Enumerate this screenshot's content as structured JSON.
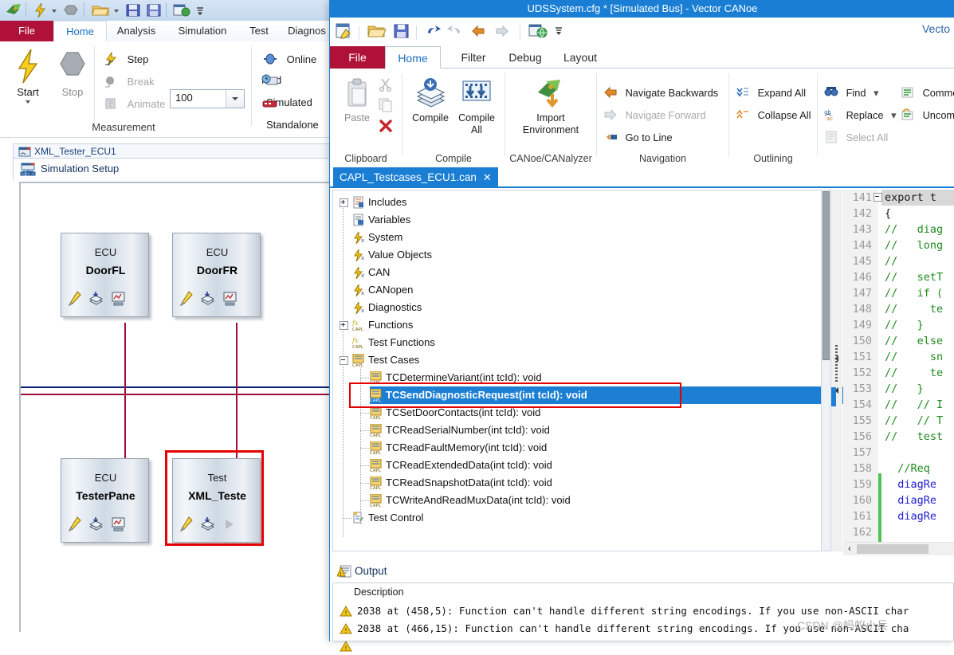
{
  "canoe": {
    "title": "UDSSystem.cfg * [Simulated Bus] - Vector CANoe",
    "tabs": [
      {
        "label": "File"
      },
      {
        "label": "Home"
      },
      {
        "label": "Analysis"
      },
      {
        "label": "Simulation"
      },
      {
        "label": "Test"
      },
      {
        "label": "Diagnos"
      }
    ],
    "ribbon": {
      "start_label": "Start",
      "stop_label": "Stop",
      "step_label": "Step",
      "break_label": "Break",
      "animate_label": "Animate",
      "step_value": "100",
      "online_mode_label": "Online Mod",
      "simulated_label": "Simulated",
      "standalone_label": "Standalone",
      "group_measurement": "Measurement"
    },
    "doc_tab": "XML_Tester_ECU1",
    "sim_header": "Simulation Setup",
    "nodes": [
      {
        "kind": "ECU",
        "name": "DoorFL",
        "selected": false,
        "third_icon": "measurement-icon"
      },
      {
        "kind": "ECU",
        "name": "DoorFR",
        "selected": false,
        "third_icon": "measurement-icon"
      },
      {
        "kind": "ECU",
        "name": "TesterPane",
        "selected": false,
        "third_icon": "measurement-icon"
      },
      {
        "kind": "Test",
        "name": "XML_Teste",
        "selected": true,
        "third_icon": "play-icon"
      }
    ],
    "colors": {
      "bus_primary": "#a10e3c",
      "bus_secondary": "#0a1f72",
      "selection_red": "#e60000",
      "file_tab": "#b01138"
    }
  },
  "capl": {
    "title": "UDSSystem.cfg * [Simulated Bus] - Vector CANoe",
    "brand": "Vecto",
    "tabs": [
      {
        "label": "File"
      },
      {
        "label": "Home"
      },
      {
        "label": "Filter"
      },
      {
        "label": "Debug"
      },
      {
        "label": "Layout"
      }
    ],
    "ribbon": {
      "clipboard": {
        "title": "Clipboard",
        "paste": "Paste",
        "cut_icon": "scissors-icon",
        "copy_icon": "copy-icon",
        "delete_icon": "delete-icon"
      },
      "compile": {
        "title": "Compile",
        "compile": "Compile",
        "compile_all_line1": "Compile",
        "compile_all_line2": "All"
      },
      "canoe": {
        "title": "CANoe/CANalyzer",
        "import_line1": "Import",
        "import_line2": "Environment"
      },
      "navigation": {
        "title": "Navigation",
        "navigate_backwards": "Navigate Backwards",
        "navigate_forward": "Navigate Forward",
        "go_to_line": "Go to Line"
      },
      "outlining": {
        "title": "Outlining",
        "expand_all": "Expand All",
        "collapse_all": "Collapse All"
      },
      "editing": {
        "find": "Find",
        "replace": "Replace",
        "select_all": "Select All",
        "comment": "Commen",
        "uncomment": "Uncomm"
      }
    },
    "file_tab": {
      "name": "CAPL_Testcases_ECU1.can",
      "close": "✕"
    },
    "tree": [
      {
        "label": "Includes",
        "icon": "includes-icon",
        "indent": 0,
        "expander": "plus"
      },
      {
        "label": "Variables",
        "icon": "variables-icon",
        "indent": 0,
        "expander": "none"
      },
      {
        "label": "System",
        "icon": "fx-bolt-icon",
        "indent": 0,
        "expander": "none"
      },
      {
        "label": "Value Objects",
        "icon": "fx-bolt-icon",
        "indent": 0,
        "expander": "none"
      },
      {
        "label": "CAN",
        "icon": "fx-bolt-icon",
        "indent": 0,
        "expander": "none"
      },
      {
        "label": "CANopen",
        "icon": "fx-bolt-icon",
        "indent": 0,
        "expander": "none"
      },
      {
        "label": "Diagnostics",
        "icon": "fx-bolt-icon",
        "indent": 0,
        "expander": "none"
      },
      {
        "label": "Functions",
        "icon": "fx-capl-icon",
        "indent": 0,
        "expander": "plus"
      },
      {
        "label": "Test Functions",
        "icon": "fx-capl-icon",
        "indent": 0,
        "expander": "none"
      },
      {
        "label": "Test Cases",
        "icon": "testcase-icon",
        "indent": 0,
        "expander": "minus"
      }
    ],
    "test_cases": [
      {
        "label": "TCDetermineVariant(int tcId): void",
        "selected": false
      },
      {
        "label": "TCSendDiagnosticRequest(int tcId): void",
        "selected": true
      },
      {
        "label": "TCSetDoorContacts(int tcId): void",
        "selected": false
      },
      {
        "label": "TCReadSerialNumber(int tcId): void",
        "selected": false
      },
      {
        "label": "TCReadFaultMemory(int tcId): void",
        "selected": false
      },
      {
        "label": "TCReadExtendedData(int tcId): void",
        "selected": false
      },
      {
        "label": "TCReadSnapshotData(int tcId): void",
        "selected": false
      },
      {
        "label": "TCWriteAndReadMuxData(int tcId): void",
        "selected": false
      }
    ],
    "test_control": {
      "label": "Test Control",
      "icon": "testcontrol-icon"
    },
    "code": {
      "first_line": 141,
      "lines": [
        {
          "n": 141,
          "text": "export t",
          "cls": "kw",
          "changed": false
        },
        {
          "n": 142,
          "text": "{",
          "cls": "kw",
          "changed": false
        },
        {
          "n": 143,
          "text": "//   diag",
          "cls": "cm",
          "changed": false
        },
        {
          "n": 144,
          "text": "//   long",
          "cls": "cm",
          "changed": false
        },
        {
          "n": 145,
          "text": "//",
          "cls": "cm",
          "changed": false
        },
        {
          "n": 146,
          "text": "//   setT",
          "cls": "cm",
          "changed": false
        },
        {
          "n": 147,
          "text": "//   if (",
          "cls": "cm",
          "changed": false
        },
        {
          "n": 148,
          "text": "//     te",
          "cls": "cm",
          "changed": false
        },
        {
          "n": 149,
          "text": "//   }",
          "cls": "cm",
          "changed": false
        },
        {
          "n": 150,
          "text": "//   else",
          "cls": "cm",
          "changed": false
        },
        {
          "n": 151,
          "text": "//     sn",
          "cls": "cm",
          "changed": false
        },
        {
          "n": 152,
          "text": "//     te",
          "cls": "cm",
          "changed": false
        },
        {
          "n": 153,
          "text": "//   }",
          "cls": "cm",
          "changed": false
        },
        {
          "n": 154,
          "text": "//   // I",
          "cls": "cm",
          "changed": false
        },
        {
          "n": 155,
          "text": "//   // T",
          "cls": "cm",
          "changed": false
        },
        {
          "n": 156,
          "text": "//   test",
          "cls": "cm",
          "changed": false
        },
        {
          "n": 157,
          "text": "",
          "cls": "kw",
          "changed": false
        },
        {
          "n": 158,
          "text": "  //Req",
          "cls": "cm",
          "changed": false
        },
        {
          "n": 159,
          "text": "  diagRe",
          "cls": "id",
          "changed": true
        },
        {
          "n": 160,
          "text": "  diagRe",
          "cls": "id",
          "changed": true
        },
        {
          "n": 161,
          "text": "  diagRe",
          "cls": "id",
          "changed": true
        },
        {
          "n": 162,
          "text": "",
          "cls": "kw",
          "changed": true
        }
      ]
    },
    "output": {
      "title": "Output",
      "column_header": "Description",
      "rows": [
        {
          "severity": "warning",
          "text": "2038 at (458,5): Function can't handle different string encodings. If you use non-ASCII char"
        },
        {
          "severity": "warning",
          "text": "2038 at (466,15): Function can't handle different string encodings. If you use non-ASCII cha"
        },
        {
          "severity": "warning",
          "text": ""
        }
      ]
    }
  },
  "watermark": "CSDN @蚂蚁小兵"
}
